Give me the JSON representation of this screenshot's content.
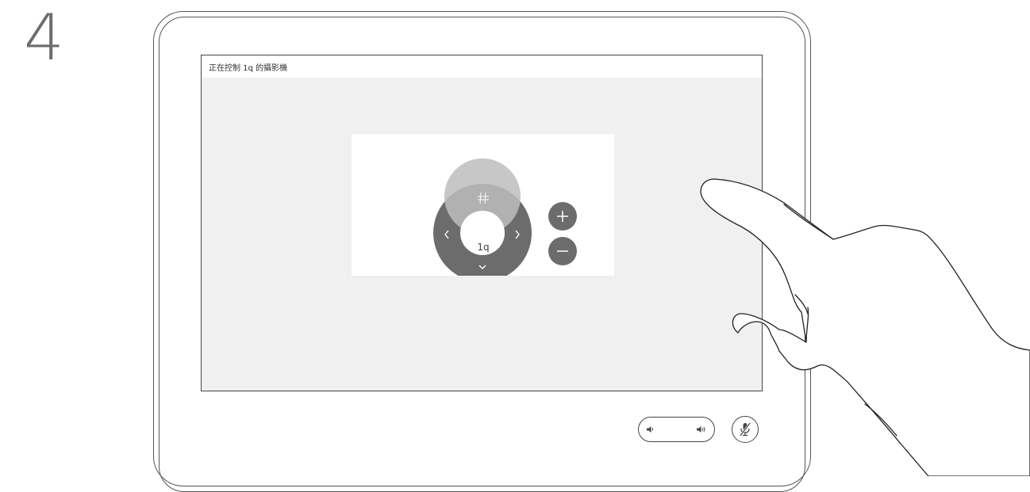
{
  "step": {
    "number": "4"
  },
  "screen": {
    "title": "正在控制 1q 的攝影機"
  },
  "camera_control": {
    "camera_label": "1q",
    "zoom_in_symbol": "+",
    "zoom_out_symbol": "—",
    "pan_left_symbol": "‹",
    "pan_right_symbol": "›",
    "tilt_up_symbol": "⌃",
    "tilt_down_symbol": "⌄"
  },
  "colors": {
    "dpad": "#6c6c6c",
    "zoom_buttons": "#6c6c6c",
    "touch_highlight": "#c5c5c5",
    "screen_bg": "#eff0ef"
  },
  "icons": {
    "volume_down": "volume-down-icon",
    "volume_up": "volume-up-icon",
    "mute": "microphone-muted-icon",
    "hand": "pointing-hand"
  }
}
